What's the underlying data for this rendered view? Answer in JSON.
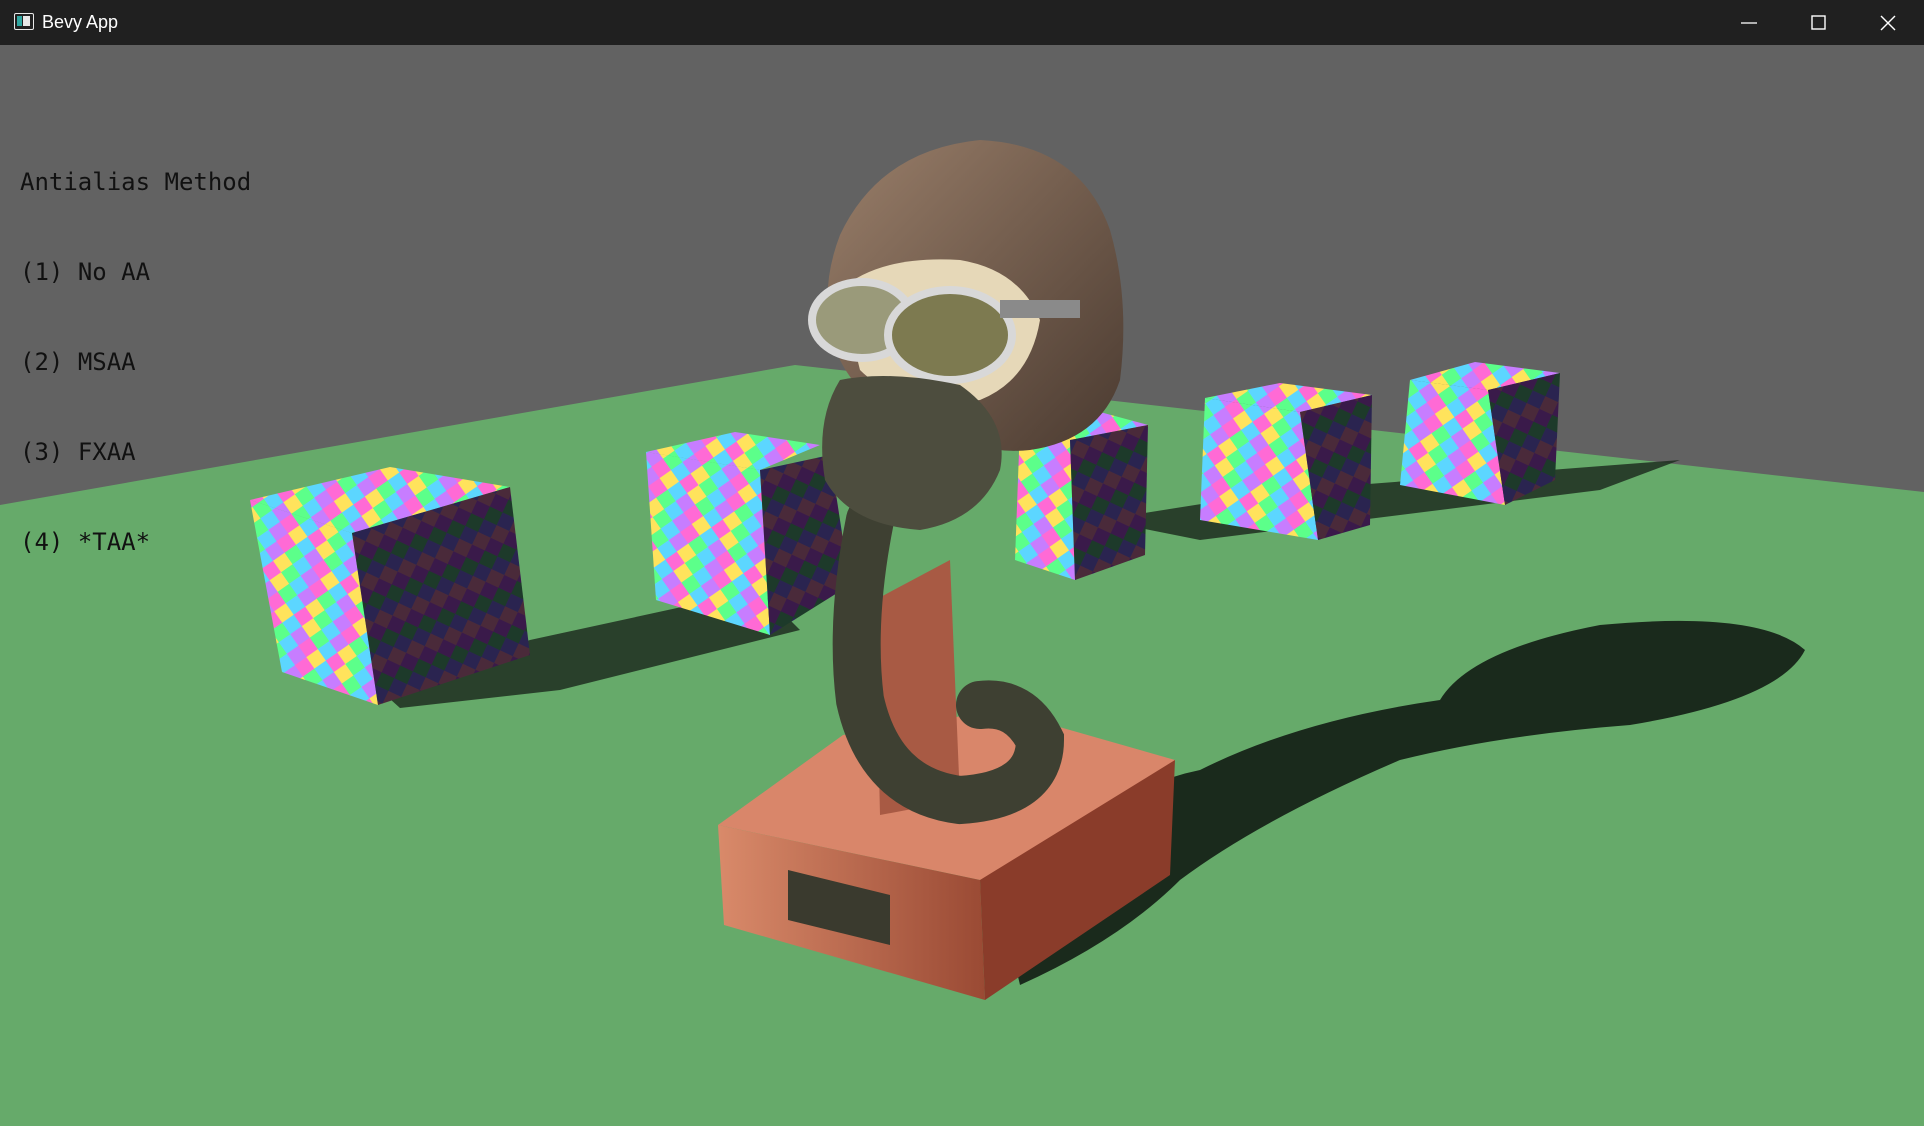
{
  "window": {
    "title": "Bevy App",
    "controls": [
      "minimize",
      "maximize",
      "close"
    ]
  },
  "overlay": {
    "heading": "Antialias Method",
    "options": [
      {
        "key": "(1)",
        "label": "No AA",
        "selected": false
      },
      {
        "key": "(2)",
        "label": "MSAA",
        "selected": false
      },
      {
        "key": "(3)",
        "label": "FXAA",
        "selected": false
      },
      {
        "key": "(4)",
        "label": "*TAA*",
        "selected": true
      }
    ]
  },
  "scene": {
    "sky_color": "#626262",
    "ground_color": "#66aa6a",
    "shadow_color": "#1a2a1c",
    "base_color": "#c06a4e",
    "helmet_color": "#7a6352",
    "mask_color": "#4d4d3e",
    "cube_texture": "rainbow-checker",
    "cube_count": 5
  }
}
